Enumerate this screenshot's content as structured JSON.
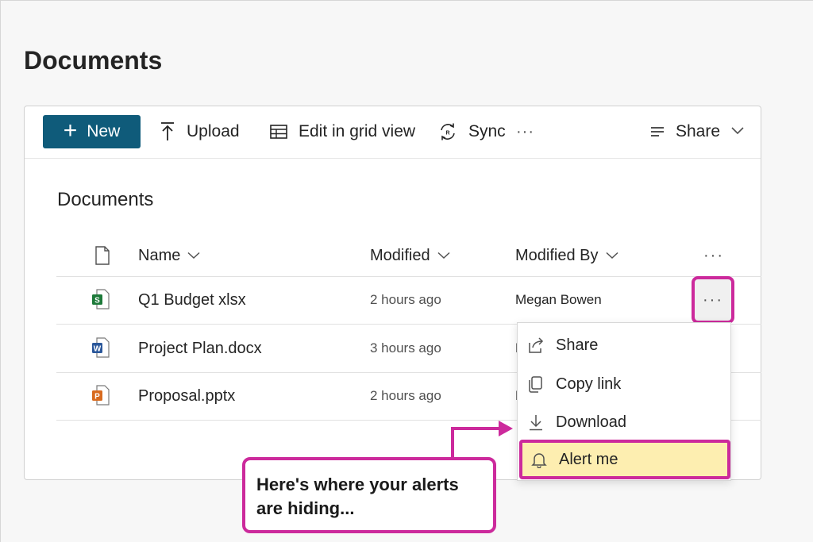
{
  "page": {
    "title": "Documents"
  },
  "toolbar": {
    "new_label": "New",
    "upload_label": "Upload",
    "edit_grid_label": "Edit in grid view",
    "sync_label": "Sync",
    "more_label": "···",
    "share_label": "Share"
  },
  "library": {
    "heading": "Documents",
    "columns": {
      "name": "Name",
      "modified": "Modified",
      "modified_by": "Modified By",
      "more": "···"
    },
    "rows": [
      {
        "name": "Q1 Budget xlsx",
        "modified": "2 hours ago",
        "modified_by": "Megan Bowen",
        "icon": "excel-file-icon",
        "icon_color": "#1d7a3a",
        "badge": "S"
      },
      {
        "name": "Project Plan.docx",
        "modified": "3 hours ago",
        "modified_by": "M",
        "icon": "word-file-icon",
        "icon_color": "#2b579a",
        "badge": "W"
      },
      {
        "name": "Proposal.pptx",
        "modified": "2 hours ago",
        "modified_by": "M",
        "icon": "powerpoint-file-icon",
        "icon_color": "#d86b1f",
        "badge": "P"
      }
    ],
    "row_more": "···"
  },
  "context_menu": {
    "items": [
      {
        "label": "Share",
        "icon": "share-icon"
      },
      {
        "label": "Copy link",
        "icon": "copy-link-icon"
      },
      {
        "label": "Download",
        "icon": "download-icon"
      },
      {
        "label": "Alert me",
        "icon": "bell-icon"
      }
    ]
  },
  "callout": {
    "line1": "Here's where your alerts",
    "line2": "are hiding..."
  },
  "colors": {
    "accent": "#0f5b7a",
    "highlight_border": "#cc2a9c",
    "highlight_fill": "#fdeeb0"
  }
}
